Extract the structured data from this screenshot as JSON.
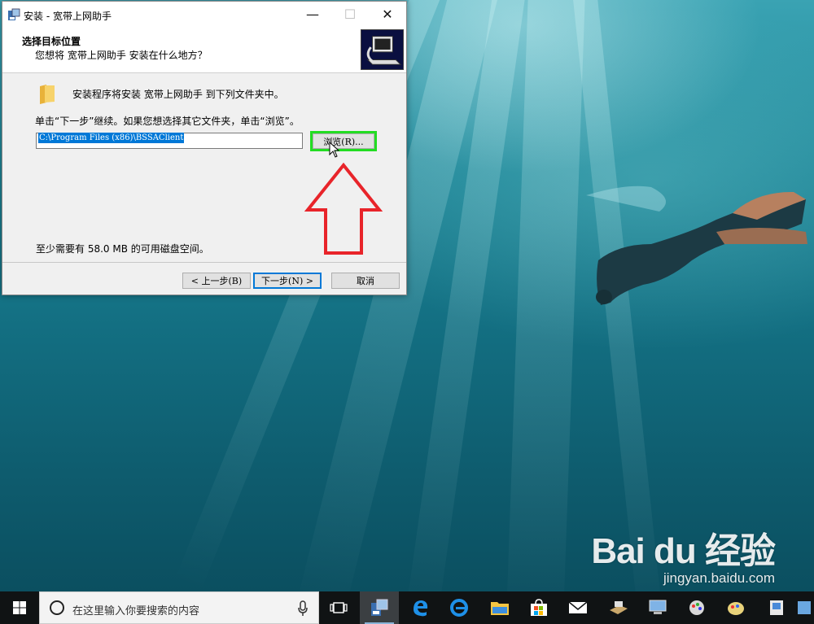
{
  "window": {
    "title": "安装 - 宽带上网助手",
    "header_title": "选择目标位置",
    "header_subtitle": "您想将 宽带上网助手 安装在什么地方？",
    "intro_text": "安装程序将安装 宽带上网助手 到下列文件夹中。",
    "instruction_text": "单击“下一步”继续。如果您想选择其它文件夹，单击“浏览”。",
    "install_path": "C:\\Program Files (x86)\\BSSAClient",
    "browse_label": "浏览(R)...",
    "disk_space_text": "至少需要有 58.0 MB 的可用磁盘空间。",
    "back_label": "< 上一步(B)",
    "next_label": "下一步(N) >",
    "cancel_label": "取消",
    "controls": {
      "minimize": "—",
      "maximize": "☐",
      "close": "✕"
    }
  },
  "taskbar": {
    "search_placeholder": "在这里输入你要搜索的内容",
    "icons": [
      "task-view-icon",
      "installer-icon",
      "edge-icon",
      "ie-icon",
      "file-explorer-icon",
      "store-icon",
      "mail-icon",
      "app-icon-7",
      "app-icon-8",
      "app-icon-9",
      "app-icon-10",
      "app-icon-11",
      "app-icon-12"
    ]
  },
  "watermark": {
    "logo": "Bai du 经验",
    "url": "jingyan.baidu.com"
  },
  "colors": {
    "highlight_border": "#22dd22",
    "annotation_arrow": "#e8242a",
    "selection": "#0078d7"
  }
}
